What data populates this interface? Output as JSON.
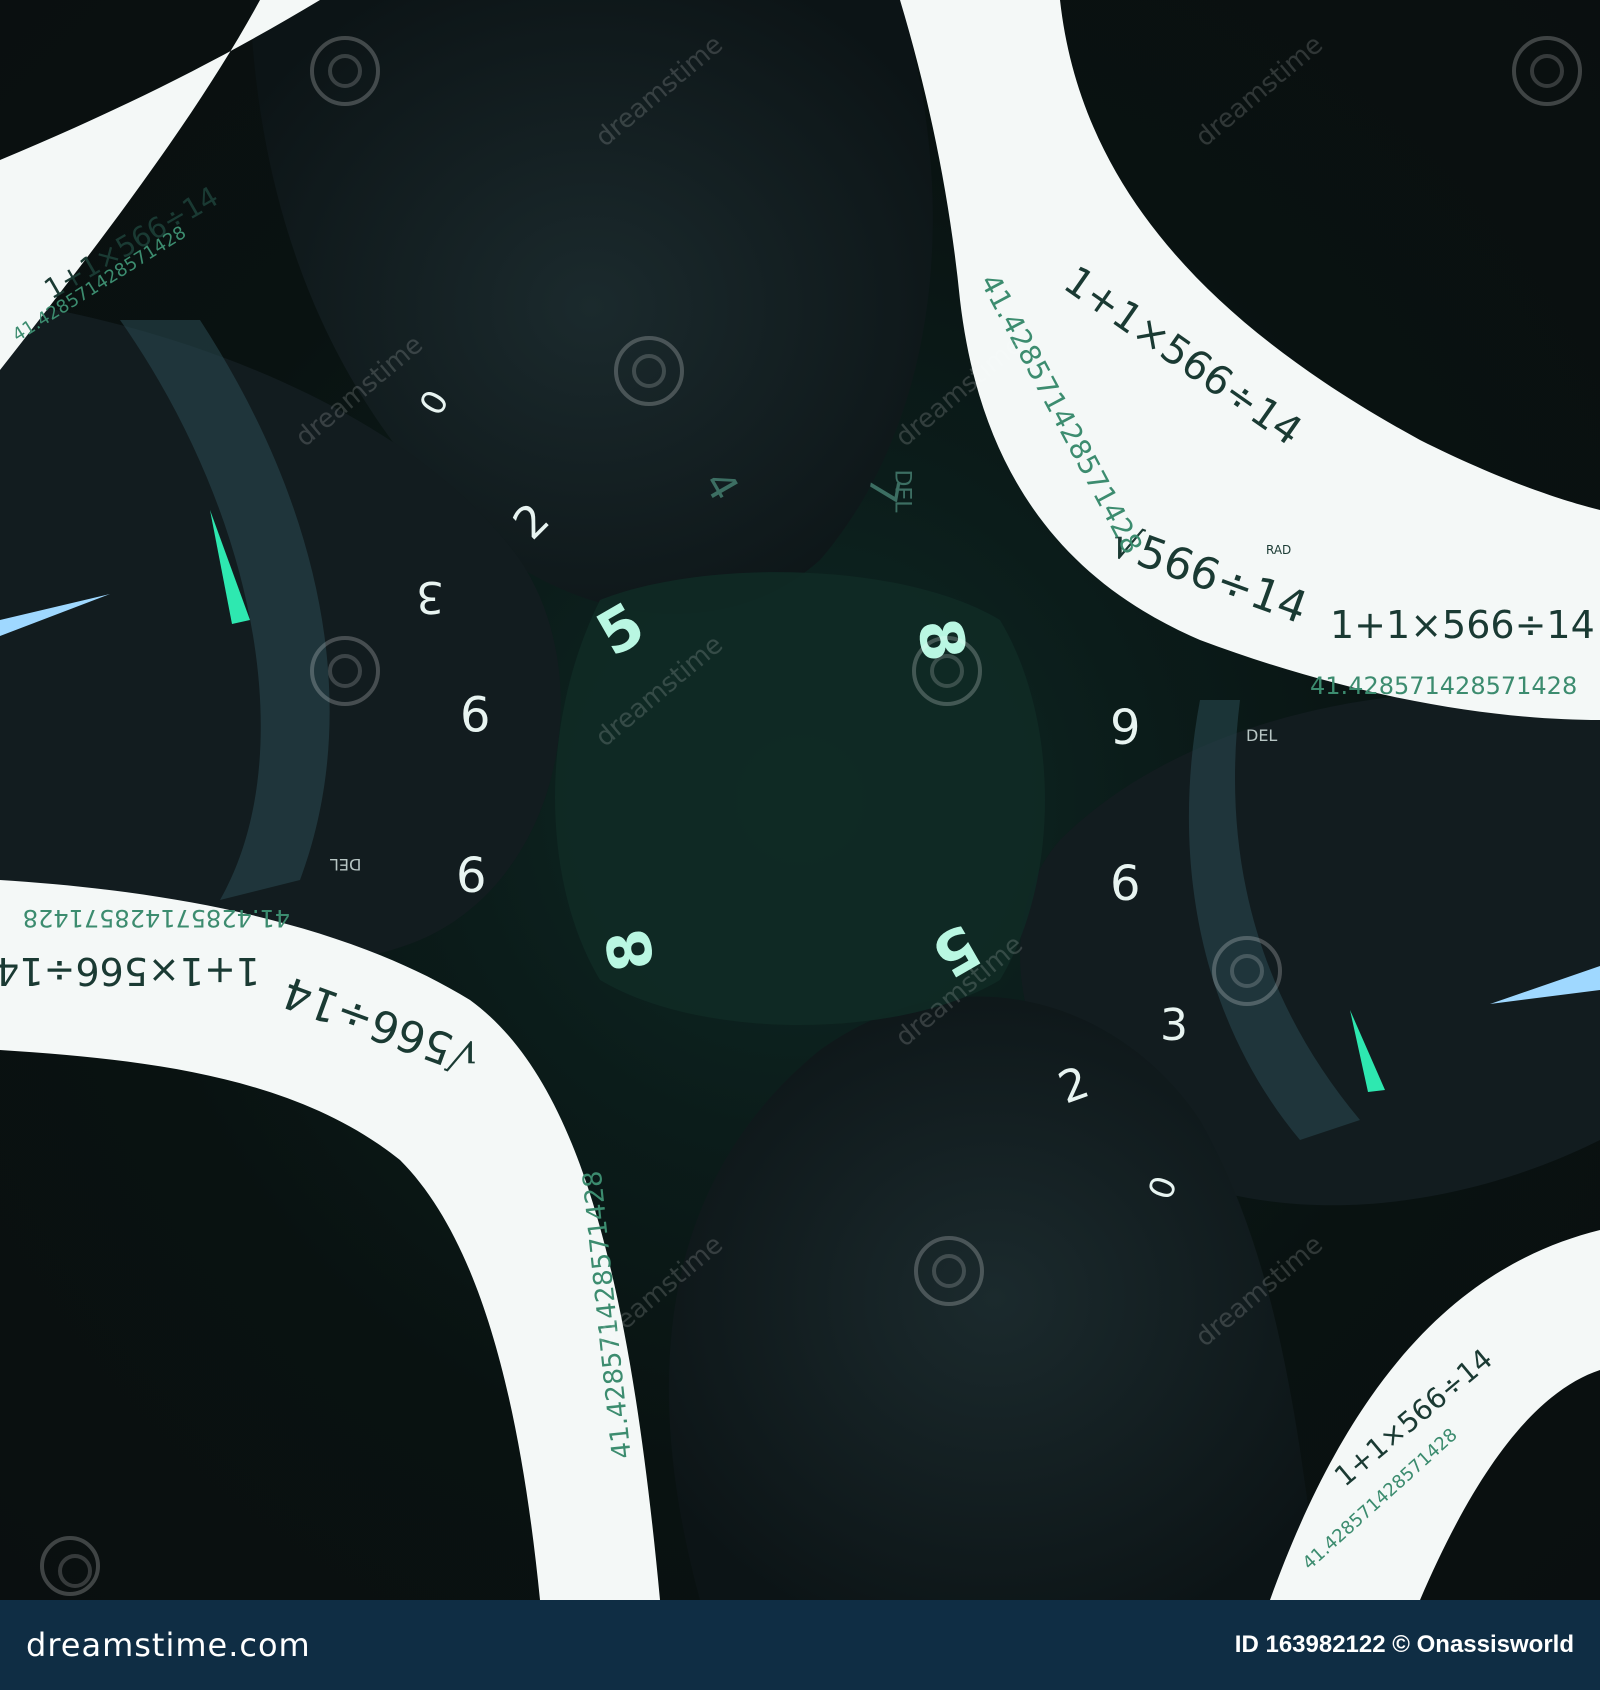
{
  "image": {
    "palette": {
      "background": "#0b1514",
      "accent_mint": "#2ee8b0",
      "ribbon": "#f4f8f7",
      "ribbon_text": "#1a3a33",
      "ribbon_text_green": "#3c8c6f",
      "digit": "#e8f4f1",
      "footer_bar": "#0f2d44"
    },
    "central_digits": [
      "5",
      "8",
      "8",
      "5",
      "6",
      "6",
      "9",
      "9",
      "2",
      "3",
      "2",
      "3",
      "0",
      "0",
      "7",
      "4"
    ],
    "ribbon_strings": {
      "expression": "1+1×566÷14",
      "result": "41.428571428571428",
      "expression_short": "1+1×566÷14",
      "mixed": "√566÷14",
      "key_del": "DEL",
      "key_rad": "RAD"
    },
    "watermark_text": "dreamstime"
  },
  "footer": {
    "logo": "dreamstime.com",
    "credit": "ID 163982122 © Onassisworld"
  }
}
